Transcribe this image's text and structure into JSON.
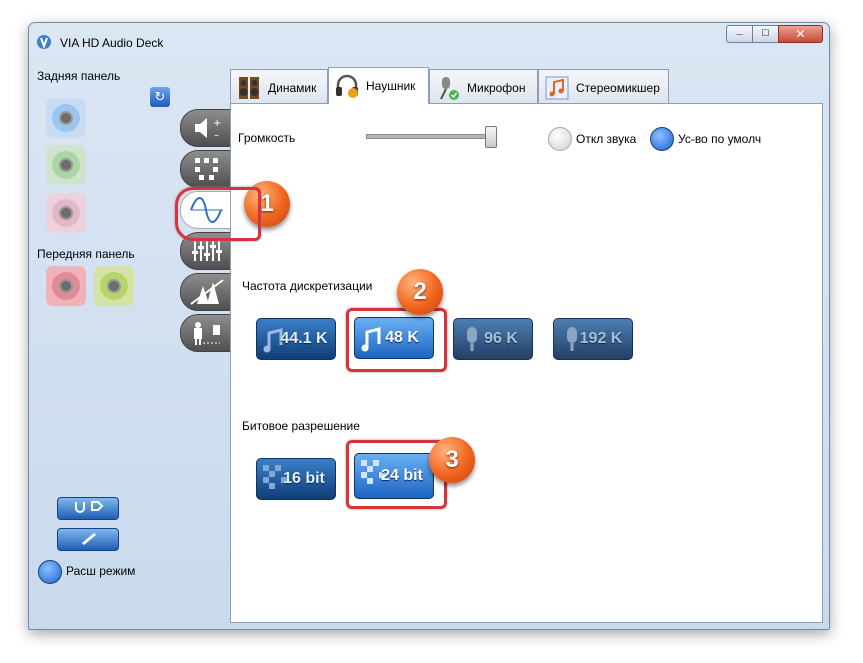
{
  "window": {
    "title": "VIA HD Audio Deck",
    "close_glyph": "✕",
    "min_glyph": "_",
    "max_glyph": "□"
  },
  "left_panel": {
    "rear_label": "Задняя панель",
    "front_label": "Передняя панель",
    "expand_mode_label": "Расш режим",
    "rear_jacks": [
      {
        "color": "#9cc6ec"
      },
      {
        "color": "#a9d6a4"
      },
      {
        "color": "#e2b8c8"
      }
    ],
    "front_jacks": [
      {
        "color": "#e08a96"
      },
      {
        "color": "#b7d46a"
      }
    ]
  },
  "tabs": [
    {
      "label": "Динамик",
      "icon": "speaker-icon"
    },
    {
      "label": "Наушник",
      "icon": "headphones-icon"
    },
    {
      "label": "Микрофон",
      "icon": "microphone-icon"
    },
    {
      "label": "Стереомикшер",
      "icon": "music-note-icon"
    }
  ],
  "volume": {
    "label": "Громкость",
    "mute_label": "Откл звука",
    "default_label": "Ус-во по умолч",
    "level": 1.0
  },
  "sample_rate": {
    "label": "Частота дискретизации",
    "options": [
      {
        "label": "44.1 K",
        "state": "available"
      },
      {
        "label": "48 K",
        "state": "selected"
      },
      {
        "label": "96 K",
        "state": "disabled"
      },
      {
        "label": "192 K",
        "state": "disabled"
      }
    ]
  },
  "bit_depth": {
    "label": "Битовое разрешение",
    "options": [
      {
        "label": "16 bit",
        "state": "available"
      },
      {
        "label": "24 bit",
        "state": "selected"
      }
    ]
  },
  "callouts": [
    "1",
    "2",
    "3"
  ],
  "colors": {
    "highlight": "#d8333a",
    "callout": "#f0641e",
    "accent_blue": "#1d64c2"
  }
}
